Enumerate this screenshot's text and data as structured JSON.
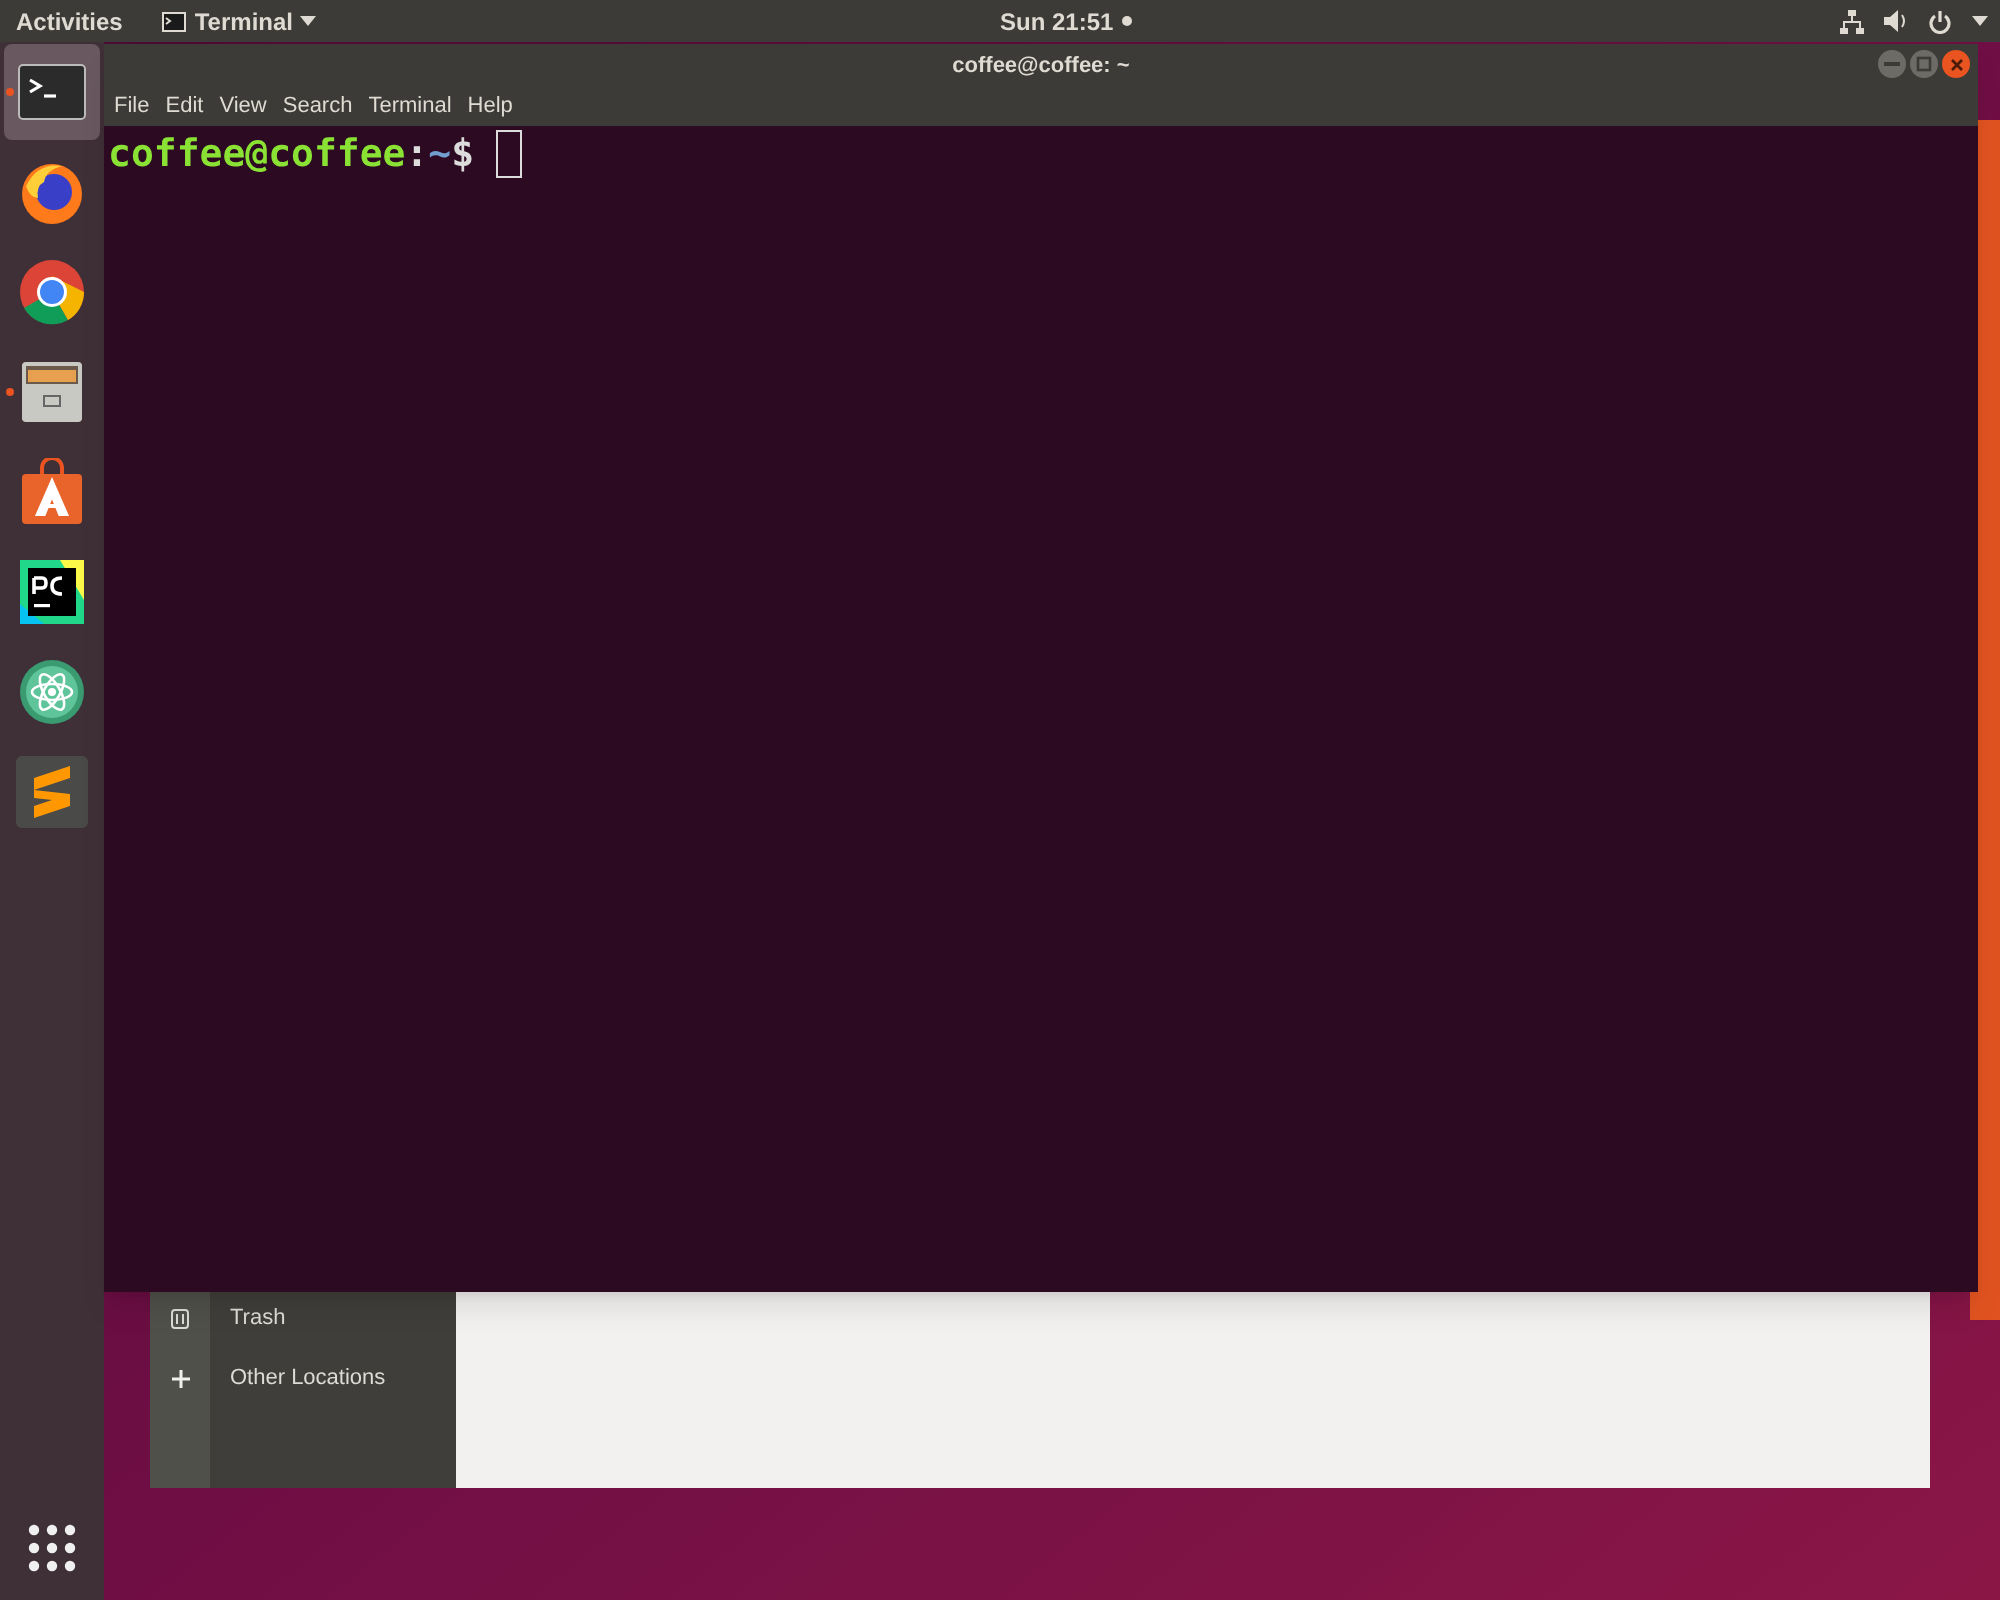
{
  "top_bar": {
    "activities": "Activities",
    "app_menu": "Terminal",
    "clock": "Sun 21:51"
  },
  "dock": {
    "items": [
      {
        "kind": "terminal",
        "running": true,
        "selected": true
      },
      {
        "kind": "firefox",
        "running": false,
        "selected": false
      },
      {
        "kind": "chrome",
        "running": false,
        "selected": false
      },
      {
        "kind": "files",
        "running": true,
        "selected": false
      },
      {
        "kind": "software",
        "running": false,
        "selected": false
      },
      {
        "kind": "pycharm",
        "running": false,
        "selected": false
      },
      {
        "kind": "atom",
        "running": false,
        "selected": false
      },
      {
        "kind": "sublime",
        "running": false,
        "selected": false
      }
    ]
  },
  "terminal": {
    "title": "coffee@coffee: ~",
    "menu": [
      "File",
      "Edit",
      "View",
      "Search",
      "Terminal",
      "Help"
    ],
    "prompt_user": "coffee@coffee",
    "prompt_sep": ":",
    "prompt_path": "~",
    "prompt_symbol": "$"
  },
  "files_window": {
    "sidebar": [
      {
        "kind": "trash",
        "label": "Trash"
      },
      {
        "kind": "plus",
        "label": "Other Locations"
      }
    ]
  }
}
